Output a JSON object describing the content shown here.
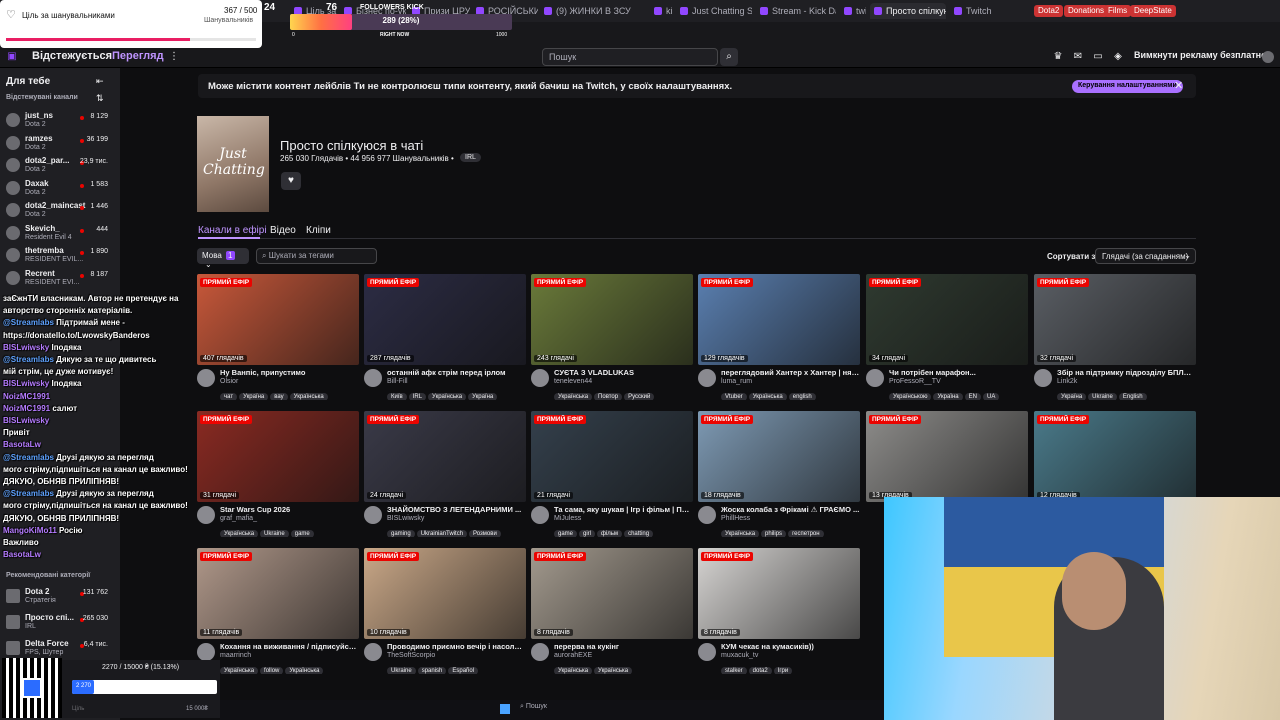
{
  "colors": {
    "accent": "#9147ff",
    "live": "#eb0400",
    "bg": "#0e0e10",
    "panel": "#1f1f23"
  },
  "browser_tabs": [
    {
      "label": "Ціль за шанувальниками",
      "active": false
    },
    {
      "label": "Бізнес по-ук...",
      "active": false
    },
    {
      "label": "Призи ЦРУ по...",
      "active": false
    },
    {
      "label": "РОСІЙСЬКИЙ",
      "active": false
    },
    {
      "label": "(9) ЖИНКИ В ЗСУ",
      "active": false
    },
    {
      "label": "kick",
      "active": false
    },
    {
      "label": "Just Chatting Str...",
      "active": false
    },
    {
      "label": "Stream - Kick Da...",
      "active": false
    },
    {
      "label": "twitch",
      "active": false
    },
    {
      "label": "Просто спілкую...",
      "active": true
    },
    {
      "label": "Twitch",
      "active": false
    }
  ],
  "bookmark_pills": [
    "Dota2",
    "Donations",
    "Films",
    "DeepState"
  ],
  "overlay": {
    "goal_title": "Ціль за шанувальниками",
    "goal_count": "367 / 500",
    "goal_subtitle": "Шанувальників",
    "goal_progress": 0.734,
    "followers_label": "FOLLOWERS KICK",
    "followers_value": "289 (28%)",
    "followers_progress": 0.28,
    "followers_min": "0",
    "followers_now": "RIGHT NOW",
    "followers_max": "1000",
    "viewer_count_a": "24",
    "viewer_count_b": "76"
  },
  "topnav": {
    "following": "Відстежується",
    "browse": "Перегляд",
    "search_placeholder": "Пошук",
    "adfree": "Вимкнути рекламу безплатно"
  },
  "sidebar": {
    "for_you": "Для тебе",
    "followed": "Відстежувані канали",
    "recommended": "Рекомендовані категорії",
    "channels": [
      {
        "name": "just_ns",
        "game": "Dota 2",
        "viewers": "8 129"
      },
      {
        "name": "ramzes",
        "game": "Dota 2",
        "viewers": "36 199"
      },
      {
        "name": "dota2_par...",
        "game": "Dota 2",
        "viewers": "23,9 тис."
      },
      {
        "name": "Daxak",
        "game": "Dota 2",
        "viewers": "1 583"
      },
      {
        "name": "dota2_maincast",
        "game": "Dota 2",
        "viewers": "1 446"
      },
      {
        "name": "Skevich_",
        "game": "Resident Evil 4",
        "viewers": "444"
      },
      {
        "name": "thetremba",
        "game": "RESIDENT EVIL...",
        "viewers": "1 890"
      },
      {
        "name": "Recrent",
        "game": "RESIDENT EVI...",
        "viewers": "8 187"
      }
    ],
    "categories": [
      {
        "name": "Dota 2",
        "game": "Стратегія",
        "viewers": "131 762"
      },
      {
        "name": "Просто спі...",
        "game": "IRL",
        "viewers": "265 030"
      },
      {
        "name": "Delta Force",
        "game": "FPS, Шутер",
        "viewers": "6,4 тис."
      }
    ]
  },
  "chat": [
    {
      "user": "",
      "text": "заЄжнТИ власникам. Автор не претендує на"
    },
    {
      "user": "",
      "text": "авторство сторонніх матеріалів."
    },
    {
      "user": "@Streamlabs",
      "text": "Підтримай мене -"
    },
    {
      "user": "",
      "text": "https://donatello.to/LwowskyBanderos"
    },
    {
      "user": "BISLwiwsky",
      "text": "Іподяка"
    },
    {
      "user": "@Streamlabs",
      "text": "Дякую за те що дивитесь"
    },
    {
      "user": "",
      "text": "мій стрім, це дуже мотивує!"
    },
    {
      "user": "BISLwiwsky",
      "text": "Іподяка"
    },
    {
      "user": "NoizMC1991",
      "text": ""
    },
    {
      "user": "NoizMC1991",
      "text": "салют"
    },
    {
      "user": "BISLwiwsky",
      "text": ""
    },
    {
      "user": "",
      "text": "Привіт"
    },
    {
      "user": "BasotaLw",
      "text": ""
    },
    {
      "user": "@Streamlabs",
      "text": "Друзі дякую за перегляд"
    },
    {
      "user": "",
      "text": "мого стріму,підпишіться на канал це важливо!"
    },
    {
      "user": "",
      "text": "ДЯКУЮ, ОБНЯВ ПРИЛІПНЯВ!"
    },
    {
      "user": "@Streamlabs",
      "text": "Друзі дякую за перегляд"
    },
    {
      "user": "",
      "text": "мого стріму,підпишіться на канал це важливо!"
    },
    {
      "user": "",
      "text": "ДЯКУЮ, ОБНЯВ ПРИЛІПНЯВ!"
    },
    {
      "user": "MangoKiMo11",
      "text": "Росію"
    },
    {
      "user": "",
      "text": "Важливо"
    },
    {
      "user": "BasotaLw",
      "text": ""
    }
  ],
  "banner": {
    "text": "Може містити контент лейблів Ти не контролюєш типи контенту, який бачиш на Twitch, у своїх налаштуваннях.",
    "manage": "Керування налаштуваннями"
  },
  "category": {
    "cover_text": "Just Chatting",
    "title": "Просто спілкуюся в чаті",
    "stats": "265 030 Глядачів  •  44 956 977 Шанувальників  •",
    "tag": "IRL",
    "tabs": [
      "Канали в ефірі",
      "Відео",
      "Кліпи"
    ],
    "lang_label": "Мова",
    "lang_count": "1",
    "tag_search_placeholder": "Шукати за тегами",
    "sort_label": "Сортувати за",
    "sort_value": "Глядачі (за спаданням)"
  },
  "live_label": "ПРЯМИЙ ЕФІР",
  "cards": [
    {
      "viewers": "407 глядачів",
      "title": "Ну Ванпіс, припустимо",
      "channel": "Olsior",
      "tags": [
        "чат",
        "Україна",
        "вау",
        "Українська"
      ],
      "color": "#c8583a"
    },
    {
      "viewers": "287 глядачів",
      "title": "останній афк стрім перед ірлом",
      "channel": "Bill-Fill",
      "tags": [
        "Київ",
        "IRL",
        "Українська",
        "Україна"
      ],
      "color": "#2c2c44"
    },
    {
      "viewers": "243 глядачі",
      "title": "СУЄТА З VLADLUKAS",
      "channel": "teneleven44",
      "tags": [
        "Українська",
        "Повтор",
        "Русский"
      ],
      "color": "#6a7a3a"
    },
    {
      "viewers": "129 глядачів",
      "title": "переглядовий Хантер х Хантер | ням н...",
      "channel": "luma_rum",
      "tags": [
        "Vtuber",
        "Українська",
        "english"
      ],
      "color": "#5a7fb0"
    },
    {
      "viewers": "34 глядачі",
      "title": "Чи потрібен марафон...",
      "channel": "ProFessoR__TV",
      "tags": [
        "Українською",
        "Україна",
        "EN",
        "UA"
      ],
      "color": "#2f3a30"
    },
    {
      "viewers": "32 глядачі",
      "title": "Збір на підтримку підрозділу БПЛА Н...",
      "channel": "Link2k",
      "tags": [
        "Україна",
        "Ukraine",
        "English"
      ],
      "color": "#5a5e64"
    },
    {
      "viewers": "31 глядачі",
      "title": "Star Wars Cup 2026",
      "channel": "graf_mafia_",
      "tags": [
        "Українська",
        "Ukraine",
        "game"
      ],
      "color": "#8a2a22"
    },
    {
      "viewers": "24 глядачі",
      "title": "ЗНАЙОМСТВО З ЛЕГЕНДАРНИМИ ...",
      "channel": "BISLwiwsky",
      "tags": [
        "gaming",
        "UkrainianTwitch",
        "Розмови"
      ],
      "color": "#3a3a48"
    },
    {
      "viewers": "21 глядачі",
      "title": "Та сама, яку шукав | Ігр і фільм | Поча...",
      "channel": "MiJuless",
      "tags": [
        "game",
        "girl",
        "фільм",
        "chatting"
      ],
      "color": "#34404c"
    },
    {
      "viewers": "18 глядачів",
      "title": "Жоска колаба з Фрікамі ⚠ ГРАЄМО ...",
      "channel": "PhillHess",
      "tags": [
        "Українська",
        "philips",
        "геспетрон"
      ],
      "color": "#7e9ab4"
    },
    {
      "viewers": "13 глядачів",
      "title": "",
      "channel": "",
      "tags": [],
      "color": "#8d8c8a"
    },
    {
      "viewers": "12 глядачів",
      "title": "",
      "channel": "",
      "tags": [],
      "color": "#4a7a8a"
    },
    {
      "viewers": "11 глядачів",
      "title": "Кохання на виживання / підписуйся ❤",
      "channel": "maarrinch",
      "tags": [
        "Українська",
        "follow",
        "Українська"
      ],
      "color": "#b0988a"
    },
    {
      "viewers": "10 глядачів",
      "title": "Проводимо приємно вечір і насолод...",
      "channel": "TheSoftScorpio",
      "tags": [
        "Ukraine",
        "spanish",
        "Español"
      ],
      "color": "#caa888"
    },
    {
      "viewers": "8 глядачів",
      "title": "перерва на кукінг",
      "channel": "aurorahEXE",
      "tags": [
        "Українська",
        "Українська"
      ],
      "color": "#a39a8e"
    },
    {
      "viewers": "8 глядачів",
      "title": "КУМ чекає на кумасиків))",
      "channel": "muxacuk_tv",
      "tags": [
        "stalker",
        "dota2",
        "Ігри"
      ],
      "color": "#d6d4d2"
    }
  ],
  "donation": {
    "amount_text": "2270 / 15000 ₴ (15.13%)",
    "progress": 0.1513,
    "bar_label": "2 270",
    "min": "Ціль",
    "max": "15 000₴"
  },
  "taskbar": {
    "search": "Пошук"
  }
}
